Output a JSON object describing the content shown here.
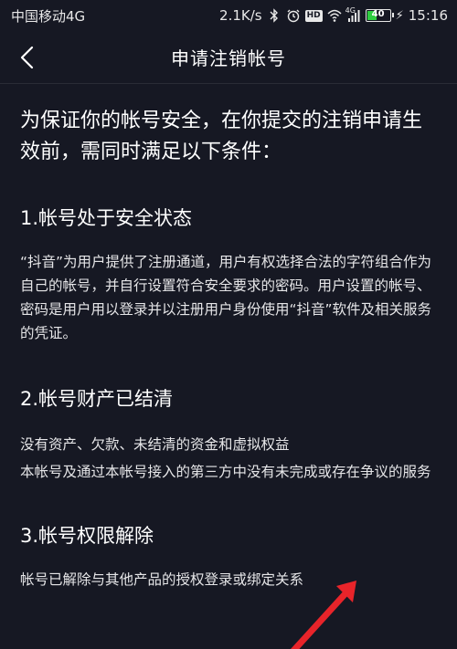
{
  "status_bar": {
    "carrier": "中国移动4G",
    "speed": "2.1K/s",
    "icons": [
      "bluetooth-icon",
      "alarm-icon",
      "hd-icon",
      "wifi-icon",
      "signal-icon",
      "battery-icon",
      "charging-icon"
    ],
    "hd": "HD",
    "network": "4G",
    "battery": "40",
    "battery_level": 0.4,
    "time": "15:16"
  },
  "header": {
    "title": "申请注销帐号",
    "back_icon": "chevron-left-icon"
  },
  "intro": "为保证你的帐号安全，在你提交的注销申请生效前，需同时满足以下条件：",
  "sections": [
    {
      "heading": "1.帐号处于安全状态",
      "paragraphs": [
        "“抖音”为用户提供了注册通道，用户有权选择合法的字符组合作为自己的帐号，并自行设置符合安全要求的密码。用户设置的帐号、密码是用户用以登录并以注册用户身份使用“抖音”软件及相关服务的凭证。"
      ]
    },
    {
      "heading": "2.帐号财产已结清",
      "paragraphs": [
        "没有资产、欠款、未结清的资金和虚拟权益",
        "本帐号及通过本帐号接入的第三方中没有未完成或存在争议的服务"
      ]
    },
    {
      "heading": "3.帐号权限解除",
      "paragraphs": [
        "帐号已解除与其他产品的授权登录或绑定关系"
      ]
    }
  ],
  "colors": {
    "background": "#161823",
    "text": "#ffffff",
    "annotation_arrow": "#e8242a"
  }
}
